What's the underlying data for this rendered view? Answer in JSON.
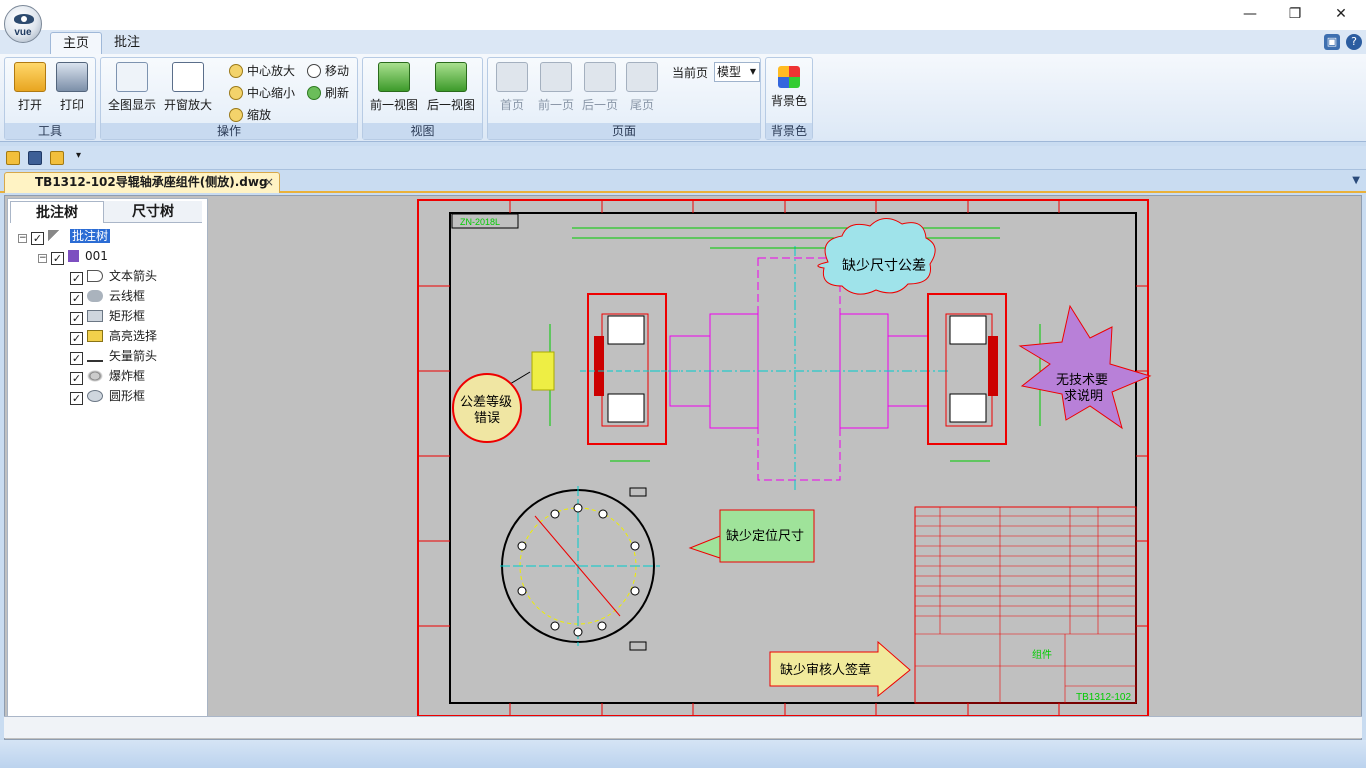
{
  "app": {
    "logo_text": "vue",
    "window_controls": {
      "minimize": "—",
      "restore": "❐",
      "close": "✕"
    }
  },
  "ribbon_tabs": [
    {
      "label": "主页",
      "active": true
    },
    {
      "label": "批注",
      "active": false
    }
  ],
  "ribbon": {
    "tools_group": {
      "label": "工具",
      "open": "打开",
      "print": "打印"
    },
    "ops_group": {
      "label": "操作",
      "fit_all": "全图显示",
      "window_zoom": "开窗放大",
      "center_zoom_in": "中心放大",
      "center_zoom_out": "中心缩小",
      "zoom": "缩放",
      "move": "移动",
      "refresh": "刷新"
    },
    "view_group": {
      "label": "视图",
      "prev_view": "前一视图",
      "next_view": "后一视图"
    },
    "page_group": {
      "label": "页面",
      "first": "首页",
      "prev": "前一页",
      "next": "后一页",
      "last": "尾页",
      "current_page_label": "当前页",
      "current_page_value": "模型"
    },
    "bg_group": {
      "label": "背景色",
      "bg_color": "背景色"
    }
  },
  "document_tab": {
    "title": "TB1312-102导辊轴承座组件(侧放).dwg",
    "close": "×"
  },
  "panel": {
    "tabs": [
      {
        "label": "批注树",
        "active": true
      },
      {
        "label": "尺寸树",
        "active": false
      }
    ],
    "tree": {
      "root": "批注树",
      "child": "001",
      "items": [
        "文本箭头",
        "云线框",
        "矩形框",
        "高亮选择",
        "矢量箭头",
        "爆炸框",
        "圆形框"
      ]
    }
  },
  "drawing": {
    "annotations": {
      "cloud": "缺少尺寸公差",
      "star": [
        "无技术要",
        "求说明"
      ],
      "circle": [
        "公差等级",
        "错误"
      ],
      "rect": "缺少定位尺寸",
      "arrow": "缺少审核人签章"
    },
    "frame_tag": "ZN-2018L",
    "title_block_code": "TB1312-102",
    "title_block_name": "组件"
  }
}
